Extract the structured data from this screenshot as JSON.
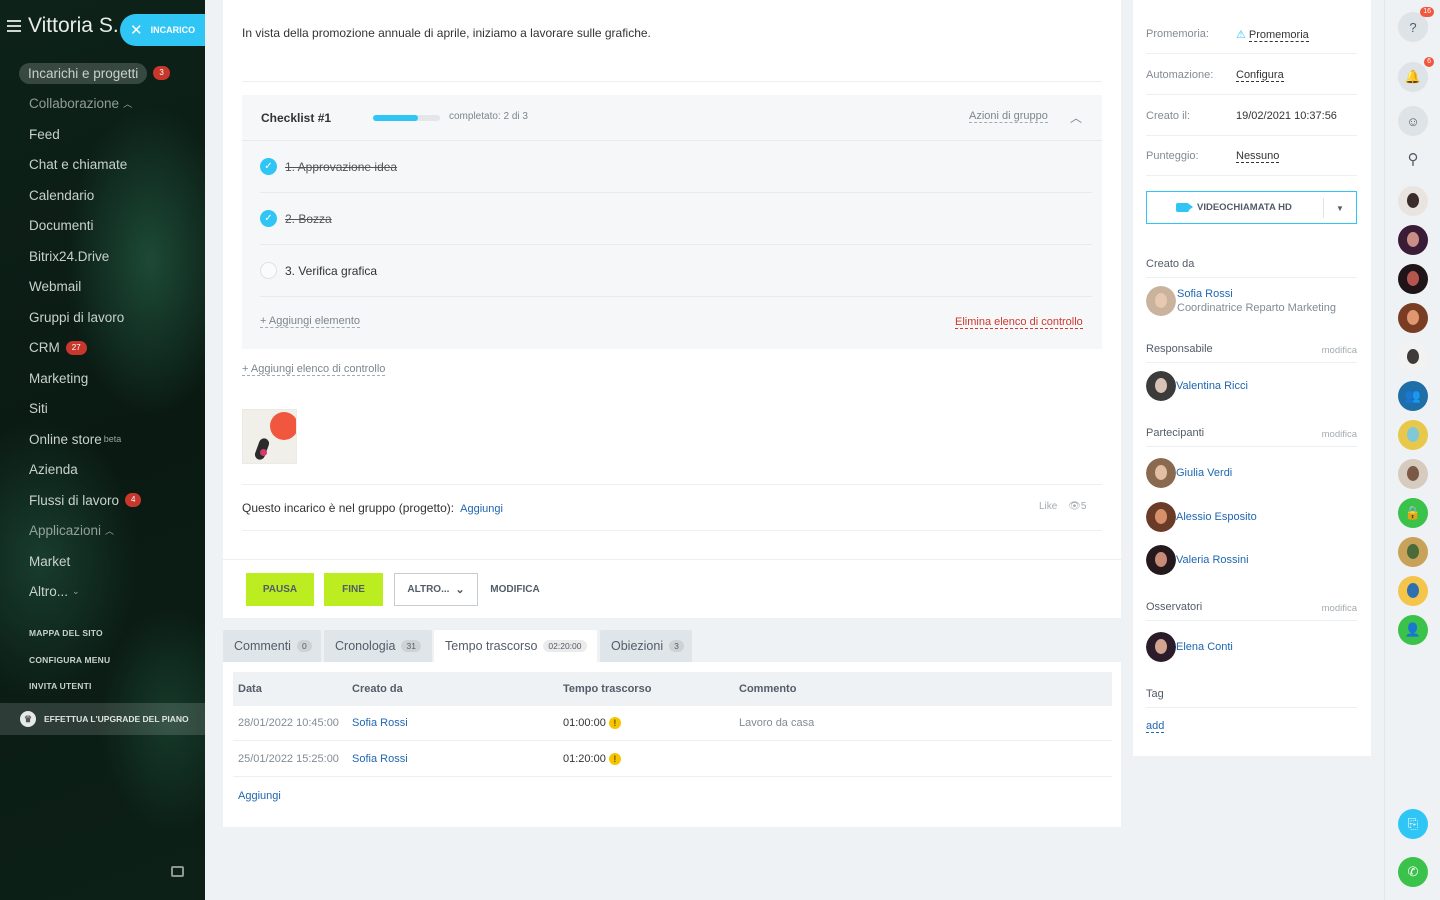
{
  "sidebar": {
    "user_name": "Vittoria S.",
    "new_task_label": "INCARICO",
    "items": [
      {
        "label": "Incarichi e progetti",
        "count": "3"
      },
      {
        "label": "Collaborazione"
      },
      {
        "label": "Feed"
      },
      {
        "label": "Chat e chiamate"
      },
      {
        "label": "Calendario"
      },
      {
        "label": "Documenti"
      },
      {
        "label": "Bitrix24.Drive"
      },
      {
        "label": "Webmail"
      },
      {
        "label": "Gruppi di lavoro"
      },
      {
        "label": "CRM",
        "count": "27"
      },
      {
        "label": "Marketing"
      },
      {
        "label": "Siti"
      },
      {
        "label": "Online store",
        "sup": "beta"
      },
      {
        "label": "Azienda"
      },
      {
        "label": "Flussi di lavoro",
        "count": "4"
      },
      {
        "label": "Applicazioni"
      },
      {
        "label": "Market"
      },
      {
        "label": "Altro..."
      }
    ],
    "links": [
      "MAPPA DEL SITO",
      "CONFIGURA MENU",
      "INVITA UTENTI"
    ],
    "upgrade_label": "EFFETTUA L'UPGRADE DEL PIANO"
  },
  "task": {
    "description": "In vista della promozione annuale di aprile, iniziamo a lavorare sulle grafiche.",
    "checklist": {
      "title": "Checklist #1",
      "progress": 0.67,
      "status": "completato: 2 di 3",
      "group_actions": "Azioni di gruppo",
      "items": [
        {
          "text": "1. Approvazione idea",
          "done": true
        },
        {
          "text": "2. Bozza",
          "done": true
        },
        {
          "text": "3. Verifica grafica",
          "done": false
        }
      ],
      "add_item": "+ Aggiungi elemento",
      "delete_list": "Elimina elenco di controllo"
    },
    "add_checklist": "+ Aggiungi elenco di controllo",
    "group_text": "Questo incarico è nel gruppo (progetto):",
    "group_add": "Aggiungi",
    "like": "Like",
    "views": "5",
    "buttons": {
      "pause": "PAUSA",
      "finish": "FINE",
      "more": "ALTRO...",
      "edit": "MODIFICA"
    }
  },
  "tabs": [
    {
      "label": "Commenti",
      "badge": "0"
    },
    {
      "label": "Cronologia",
      "badge": "31"
    },
    {
      "label": "Tempo trascorso",
      "badge": "02:20:00"
    },
    {
      "label": "Obiezioni",
      "badge": "3"
    }
  ],
  "time_table": {
    "headers": [
      "Data",
      "Creato da",
      "Tempo trascorso",
      "Commento"
    ],
    "rows": [
      {
        "date": "28/01/2022 10:45:00",
        "by": "Sofia Rossi",
        "time": "01:00:00",
        "comment": "Lavoro da casa"
      },
      {
        "date": "25/01/2022 15:25:00",
        "by": "Sofia Rossi",
        "time": "01:20:00",
        "comment": ""
      }
    ],
    "add": "Aggiungi"
  },
  "panel": {
    "props": [
      {
        "key": "Promemoria:",
        "value": "Promemoria"
      },
      {
        "key": "Automazione:",
        "value": "Configura"
      },
      {
        "key": "Creato il:",
        "value": "19/02/2021 10:37:56"
      },
      {
        "key": "Punteggio:",
        "value": "Nessuno"
      }
    ],
    "video_label": "VIDEOCHIAMATA HD",
    "created_by_title": "Creato da",
    "creator": {
      "name": "Sofia Rossi",
      "role": "Coordinatrice Reparto Marketing"
    },
    "responsible_title": "Responsabile",
    "responsible": "Valentina Ricci",
    "participants_title": "Partecipanti",
    "participants": [
      "Giulia Verdi",
      "Alessio Esposito",
      "Valeria Rossini"
    ],
    "observers_title": "Osservatori",
    "observers": [
      "Elena Conti"
    ],
    "modify": "modifica",
    "tag_title": "Tag",
    "tag_add": "add"
  },
  "rightbar": {
    "help_badge": "16",
    "notif_badge": "6"
  },
  "colors": {
    "accent": "#2fc6f6",
    "green": "#bbed21",
    "danger": "#d0382c"
  }
}
